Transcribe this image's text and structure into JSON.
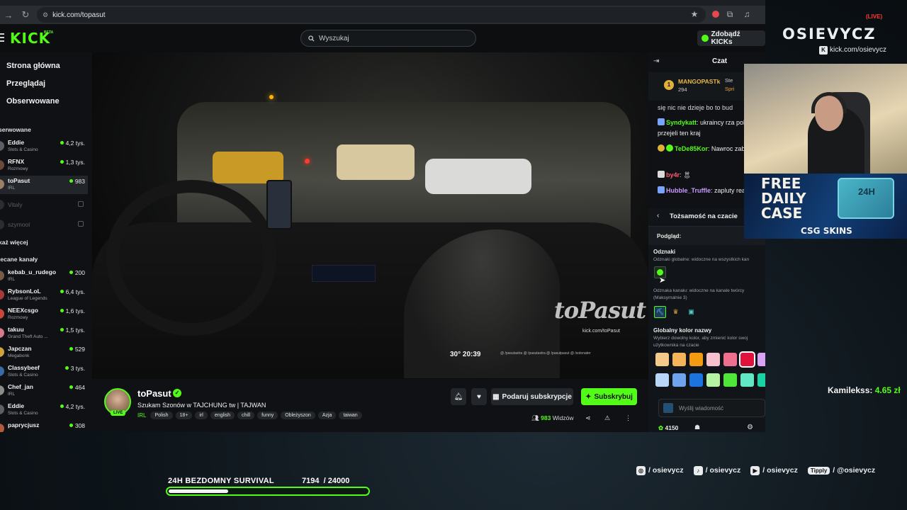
{
  "browser": {
    "url": "kick.com/topasut"
  },
  "header": {
    "logo": "KICK",
    "logo_tag": "BETA",
    "search_placeholder": "Wyszukaj",
    "get_kicks": "Zdobądź KICKs"
  },
  "sidebar": {
    "nav": [
      "Strona główna",
      "Przeglądaj",
      "Obserwowane"
    ],
    "followed_title": "serwowane",
    "followed": [
      {
        "name": "Eddie",
        "category": "Slots & Casino",
        "viewers": "4,2 tys."
      },
      {
        "name": "RFNX",
        "category": "Rozmowy",
        "viewers": "1,3 tys."
      },
      {
        "name": "toPasut",
        "category": "IRL",
        "viewers": "983"
      },
      {
        "name": "Vitaly",
        "category": "",
        "viewers": ""
      },
      {
        "name": "szymool",
        "category": "",
        "viewers": ""
      }
    ],
    "show_more": "każ więcej",
    "recommended_title": "lecane kanały",
    "recommended": [
      {
        "name": "kebab_u_rudego",
        "category": "IRL",
        "viewers": "200"
      },
      {
        "name": "RybsonLoL",
        "category": "League of Legends",
        "viewers": "6,4 tys."
      },
      {
        "name": "NEEXcsgo",
        "category": "Rozmowy",
        "viewers": "1,6 tys."
      },
      {
        "name": "takuu",
        "category": "Grand Theft Auto ...",
        "viewers": "1,5 tys."
      },
      {
        "name": "Japczan",
        "category": "Megabonk",
        "viewers": "529"
      },
      {
        "name": "Classybeef",
        "category": "Slots & Casino",
        "viewers": "3 tys."
      },
      {
        "name": "Chef_jan",
        "category": "IRL",
        "viewers": "464"
      },
      {
        "name": "Eddie",
        "category": "Slots & Casino",
        "viewers": "4,2 tys."
      },
      {
        "name": "paprycjusz",
        "category": "",
        "viewers": "308"
      }
    ]
  },
  "video": {
    "timer": "30° 20:39",
    "socials_line": "@ /pasutastra  @ /pasutastra  @ /pasutpasut  @ /sotonater",
    "watermark": "toPasut",
    "watermark_url": "kick.com/toPasut"
  },
  "stream": {
    "streamer": "toPasut",
    "live": "LIVE",
    "title": "Szukam Szonów w TAJCHUNG tw | TAJWAN",
    "category": "IRL",
    "tags": [
      "Polish",
      "18+",
      "irl",
      "english",
      "chill",
      "funny",
      "Obleżyszon",
      "Azja",
      "taiwan"
    ],
    "gift_button": "Podaruj subskrypcje",
    "subscribe_button": "Subskrybuj",
    "viewers_count": "983",
    "viewers_label": "Widzów"
  },
  "chat": {
    "title": "Czat",
    "pinned": {
      "rank": "1",
      "name": "MANGOPASTk",
      "amount": "294",
      "right1": "Ste",
      "right2": "Spri"
    },
    "messages": [
      {
        "user": "",
        "text": "się nic nie dzieje bo to bud"
      },
      {
        "user": "Syndykatt",
        "text": ": ukraincy rza polsce przejeli ten kraj",
        "color": "#53fc18"
      },
      {
        "user": "TeDe85Kor",
        "text": ": Nawroc zablokuje!",
        "color": "#53fc18"
      },
      {
        "user": "by4r",
        "text": ":",
        "color": "#ff5a6e"
      },
      {
        "user": "Hubble_Truffle",
        "text": ": zapluty reakcji",
        "color": "#c79bff"
      }
    ],
    "identity": {
      "title": "Tożsamość na czacie",
      "preview": "Podgląd:",
      "badges_title": "Odznaki",
      "badges_desc": "Odznaki globalne: widoczne na wszystkich kan",
      "channel_badges_desc": "Odznaka kanału: widoczne na kanale twórcy (Maksymalnie 3)",
      "color_title": "Globalny kolor nazwy",
      "color_desc": "Wybierz dowolny kolor, aby zmienić kolor swoj użytkownika na czacie",
      "colors_row1": [
        "#f4c98a",
        "#f5b35a",
        "#f29a12",
        "#f6c0cf",
        "#ef6f8f",
        "#e0133e",
        "#d6a3f5"
      ],
      "colors_row2": [
        "#b9d5f7",
        "#6ea3ee",
        "#1b74e0",
        "#b5f5a1",
        "#4fe639",
        "#62e7c6",
        "#19d3a4"
      ]
    },
    "input_placeholder": "Wyślij wiadomość",
    "kicks_count": "4150"
  },
  "overlay": {
    "channel": "OSIEVYCZ",
    "live": "LIVE",
    "kick_url": "kick.com/osievycz",
    "ad_line1": "FREE",
    "ad_line2": "DAILY",
    "ad_line3": "CASE",
    "ad_box": "24H",
    "ad_brand": "CSG SKINS",
    "donation_user": "Kamilekss:",
    "donation_amount": "4.65 zł",
    "goal_label": "24H BEZDOMNY SURVIVAL",
    "goal_current": "7194",
    "goal_total": "/ 24000",
    "goal_fraction": 0.2998,
    "socials": [
      {
        "icon": "instagram-icon",
        "handle": "/ osievycz"
      },
      {
        "icon": "tiktok-icon",
        "handle": "/ osievycz"
      },
      {
        "icon": "youtube-icon",
        "handle": "/ osievycz"
      },
      {
        "icon": "tipply-icon",
        "label": "Tipply",
        "handle": "/ @osievycz"
      }
    ]
  }
}
